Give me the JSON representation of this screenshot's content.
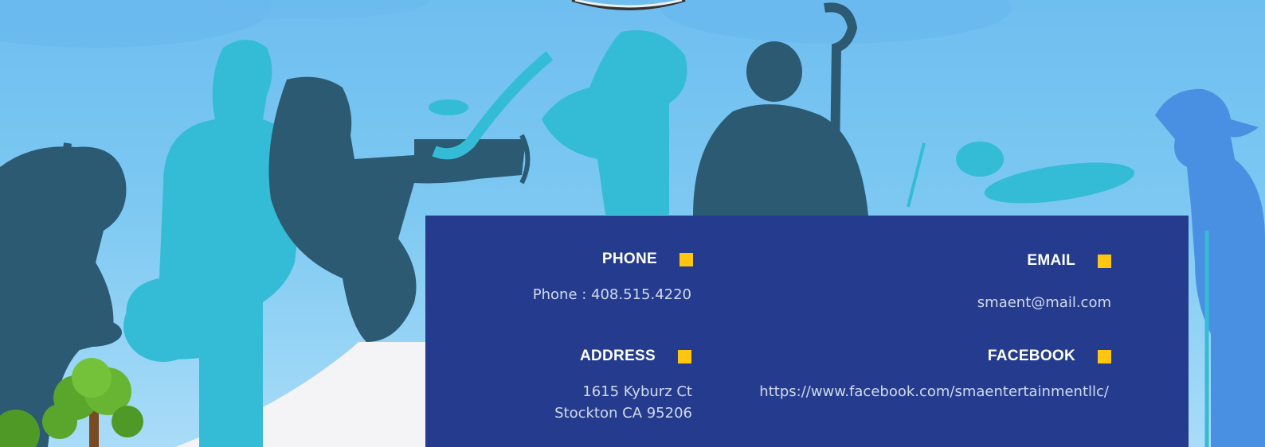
{
  "colors": {
    "panel_bg": "#253c8e",
    "accent_square": "#ffc60f",
    "heading_text": "#ffffff",
    "value_text": "#d2d9ee",
    "sky": "#7cc8f2"
  },
  "contact": {
    "phone": {
      "heading": "PHONE",
      "value": "Phone : 408.515.4220"
    },
    "email": {
      "heading": "EMAIL",
      "value": "smaent@mail.com"
    },
    "address": {
      "heading": "ADDRESS",
      "line1": "1615 Kyburz Ct",
      "line2": "Stockton CA 95206"
    },
    "facebook": {
      "heading": "FACEBOOK",
      "value": "https://www.facebook.com/smaentertainmentllc/"
    }
  }
}
